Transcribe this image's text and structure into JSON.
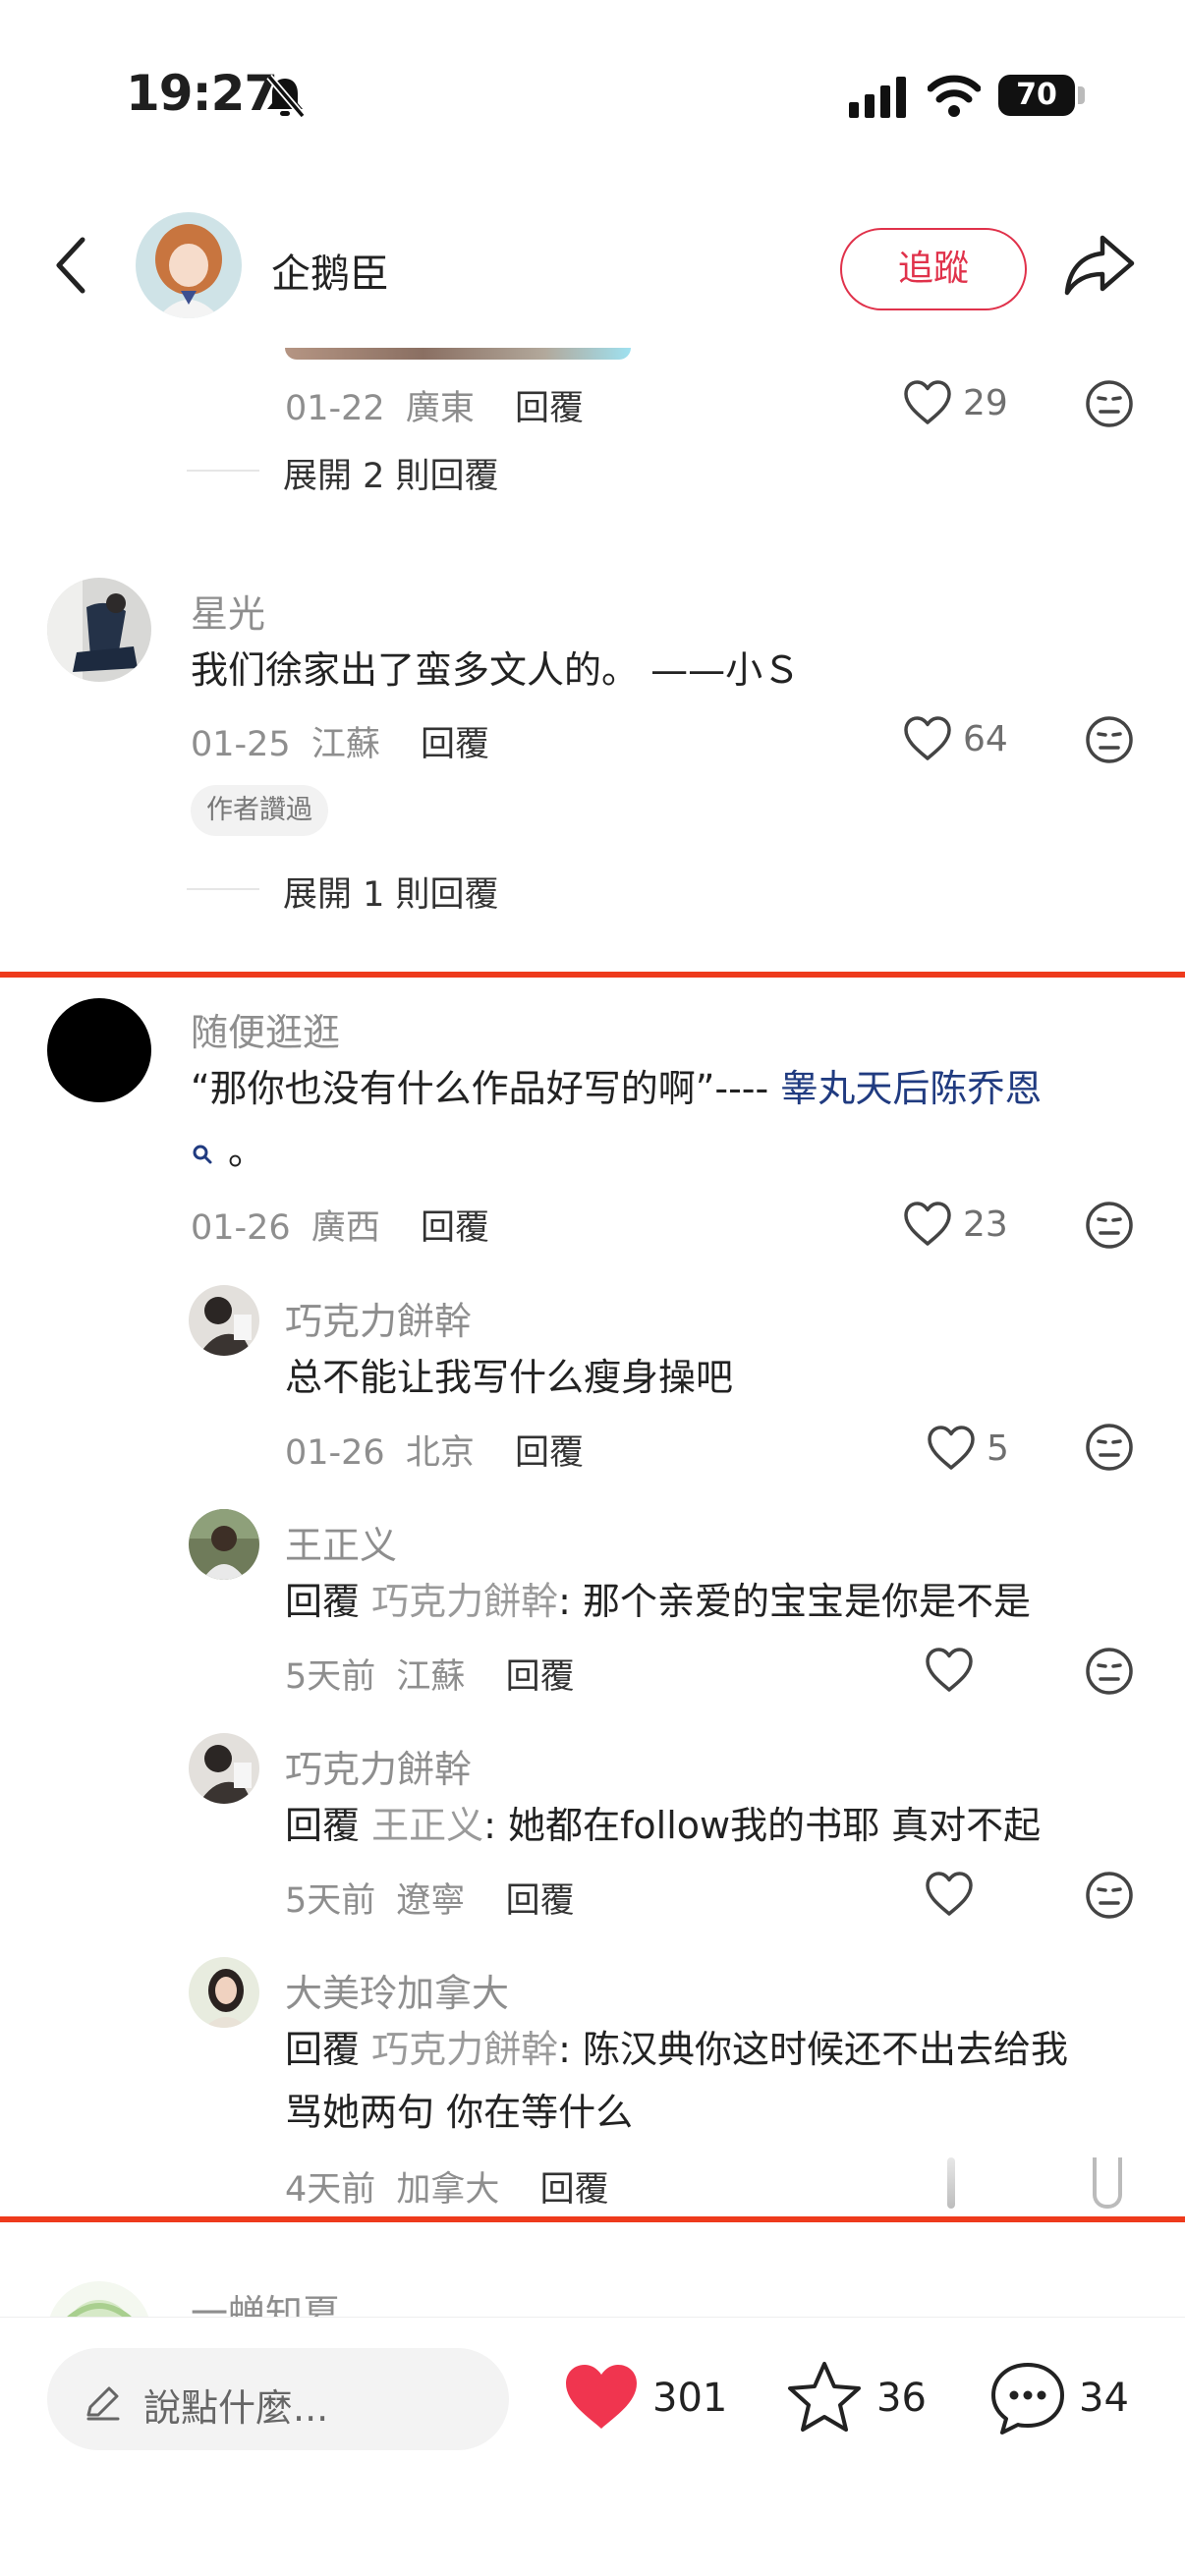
{
  "status_bar": {
    "time": "19:27",
    "battery": "70"
  },
  "header": {
    "author_name": "企鹅臣",
    "follow_label": "追蹤"
  },
  "comments": [
    {
      "date": "01-22",
      "location": "廣東",
      "reply_label": "回覆",
      "likes": "29",
      "expand_label": "展開 2 則回覆"
    },
    {
      "name": "星光",
      "text": "我们徐家出了蛮多文人的。 ——小Ｓ",
      "date": "01-25",
      "location": "江蘇",
      "reply_label": "回覆",
      "likes": "64",
      "tag": "作者讚過",
      "expand_label": "展開 1 則回覆"
    },
    {
      "name": "随便逛逛",
      "text_prefix": "“那你也没有什么作品好写的啊”---- ",
      "link_text": "睾丸天后陈乔恩",
      "text_suffix": "。",
      "date": "01-26",
      "location": "廣西",
      "reply_label": "回覆",
      "likes": "23",
      "replies": [
        {
          "name": "巧克力餅幹",
          "text": "总不能让我写什么瘦身操吧",
          "date": "01-26",
          "location": "北京",
          "reply_label": "回覆",
          "likes": "5"
        },
        {
          "name": "王正义",
          "prefix": "回覆",
          "target": "巧克力餅幹",
          "text": ": 那个亲爱的宝宝是你是不是",
          "date": "5天前",
          "location": "江蘇",
          "reply_label": "回覆",
          "likes": ""
        },
        {
          "name": "巧克力餅幹",
          "prefix": "回覆",
          "target": "王正义",
          "text": ": 她都在follow我的书耶 真对不起",
          "date": "5天前",
          "location": "遼寧",
          "reply_label": "回覆",
          "likes": ""
        },
        {
          "name": "大美玲加拿大",
          "prefix": "回覆",
          "target": "巧克力餅幹",
          "text_line1": ": 陈汉典你这时候还不出去给我",
          "text_line2": "骂她两句 你在等什么",
          "date": "4天前",
          "location": "加拿大",
          "reply_label": "回覆"
        }
      ]
    },
    {
      "name": "一蝉知夏"
    }
  ],
  "bottom_bar": {
    "input_placeholder": "說點什麼...",
    "like_count": "301",
    "star_count": "36",
    "comment_count": "34"
  },
  "colors": {
    "accent": "#e0324b",
    "highlight_line": "#ee3a1c",
    "link": "#203b80",
    "heart": "#f0354f"
  }
}
